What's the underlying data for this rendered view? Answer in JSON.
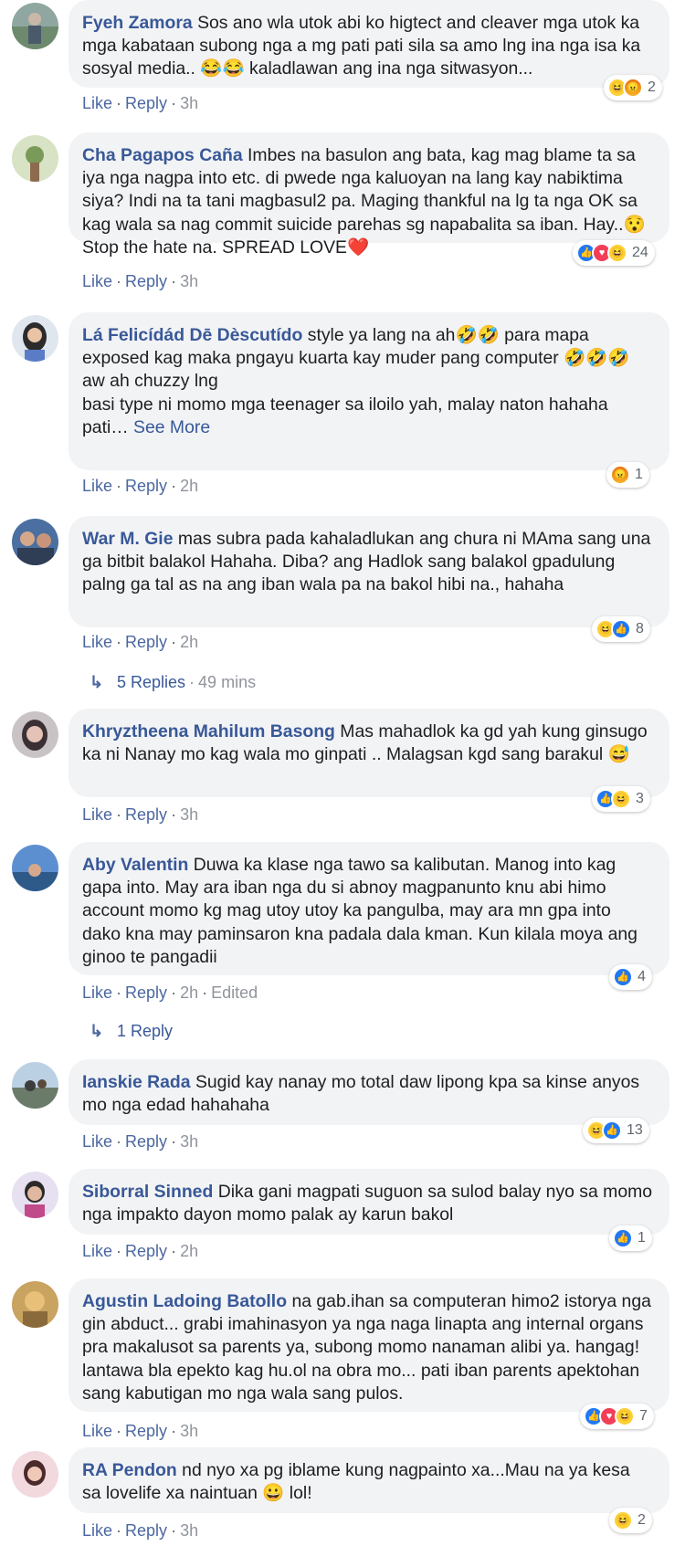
{
  "actions": {
    "like": "Like",
    "reply": "Reply",
    "sep": "·"
  },
  "colors": {
    "author": "#385898",
    "bubble": "#f2f3f5",
    "like": "#2078f4",
    "love": "#f33e58",
    "haha": "#fcd036"
  },
  "comments": [
    {
      "author": "Fyeh Zamora",
      "text": "Sos ano wla utok abi ko higtect and cleaver mga utok ka mga kabataan subong nga a mg pati pati sila sa amo lng ina nga isa ka sosyal media.. 😂😂 kaladlawan ang ina nga sitwasyon...",
      "see_more": "",
      "time": "3h",
      "edited": "",
      "reactions": [
        "haha",
        "angry"
      ],
      "reaction_count": "2"
    },
    {
      "author": "Cha Pagapos Caña",
      "text": "Imbes na basulon ang bata, kag mag blame ta sa iya nga nagpa into etc. di pwede nga kaluoyan na lang kay nabiktima siya? Indi na ta tani magbasul2 pa. Maging thankful na lg ta nga OK sa kag wala sa nag commit suicide parehas sg napabalita sa iban. Hay..😯 Stop the hate na. SPREAD LOVE❤️",
      "see_more": "",
      "time": "3h",
      "edited": "",
      "reactions": [
        "like",
        "love",
        "haha"
      ],
      "reaction_count": "24"
    },
    {
      "author": "Lá Felicídád Dē Dèscutído",
      "text": "style ya lang na ah🤣🤣 para mapa exposed kag maka pngayu kuarta kay muder pang computer 🤣🤣🤣\naw ah chuzzy lng\nbasi type ni momo mga teenager sa iloilo yah, malay naton hahaha pati…",
      "see_more": "See More",
      "time": "2h",
      "edited": "",
      "reactions": [
        "angry"
      ],
      "reaction_count": "1"
    },
    {
      "author": "War M. Gie",
      "text": "mas subra pada kahaladlukan ang chura ni MAma sang una ga bitbit balakol Hahaha. Diba? ang Hadlok sang balakol gpadulung palng ga tal as na ang iban wala pa na bakol hibi na., hahaha",
      "see_more": "",
      "time": "2h",
      "edited": "",
      "reactions": [
        "haha",
        "like"
      ],
      "reaction_count": "8",
      "replies": {
        "label": "5 Replies",
        "time": "49 mins"
      }
    },
    {
      "author": "Khryztheena Mahilum Basong",
      "text": "Mas mahadlok ka gd yah kung ginsugo ka ni Nanay mo kag wala mo ginpati .. Malagsan kgd sang barakul 😅",
      "see_more": "",
      "time": "3h",
      "edited": "",
      "reactions": [
        "like",
        "haha"
      ],
      "reaction_count": "3"
    },
    {
      "author": "Aby Valentin",
      "text": "Duwa ka klase nga tawo sa kalibutan. Manog into kag gapa into. May ara iban nga du si abnoy magpanunto knu abi himo account momo kg mag utoy utoy ka pangulba, may ara mn gpa into dako kna may paminsaron kna padala dala kman. Kun kilala moya ang ginoo te pangadii",
      "see_more": "",
      "time": "2h",
      "edited": "Edited",
      "reactions": [
        "like"
      ],
      "reaction_count": "4",
      "replies": {
        "label": "1 Reply",
        "time": ""
      }
    },
    {
      "author": "Ianskie Rada",
      "text": "Sugid kay nanay mo total daw lipong kpa sa kinse anyos mo nga edad hahahaha",
      "see_more": "",
      "time": "3h",
      "edited": "",
      "reactions": [
        "haha",
        "like"
      ],
      "reaction_count": "13"
    },
    {
      "author": "Siborral Sinned",
      "text": "Dika gani magpati suguon sa sulod balay nyo sa momo nga impakto dayon momo palak ay karun bakol",
      "see_more": "",
      "time": "2h",
      "edited": "",
      "reactions": [
        "like"
      ],
      "reaction_count": "1"
    },
    {
      "author": "Agustin Ladoing Batollo",
      "text": "na gab.ihan sa computeran himo2 istorya nga gin abduct... grabi imahinasyon ya nga naga linapta ang internal organs pra makalusot sa parents ya, subong momo nanaman alibi ya. hangag! lantawa bla epekto kag hu.ol na obra mo... pati iban parents apektohan sang kabutigan mo nga wala sang pulos.",
      "see_more": "",
      "time": "3h",
      "edited": "",
      "reactions": [
        "like",
        "love",
        "haha"
      ],
      "reaction_count": "7"
    },
    {
      "author": "RA Pendon",
      "text": "nd nyo xa pg iblame kung nagpainto xa...Mau na ya kesa sa lovelife xa naintuan 😀 lol!",
      "see_more": "",
      "time": "3h",
      "edited": "",
      "reactions": [
        "haha"
      ],
      "reaction_count": "2"
    }
  ]
}
